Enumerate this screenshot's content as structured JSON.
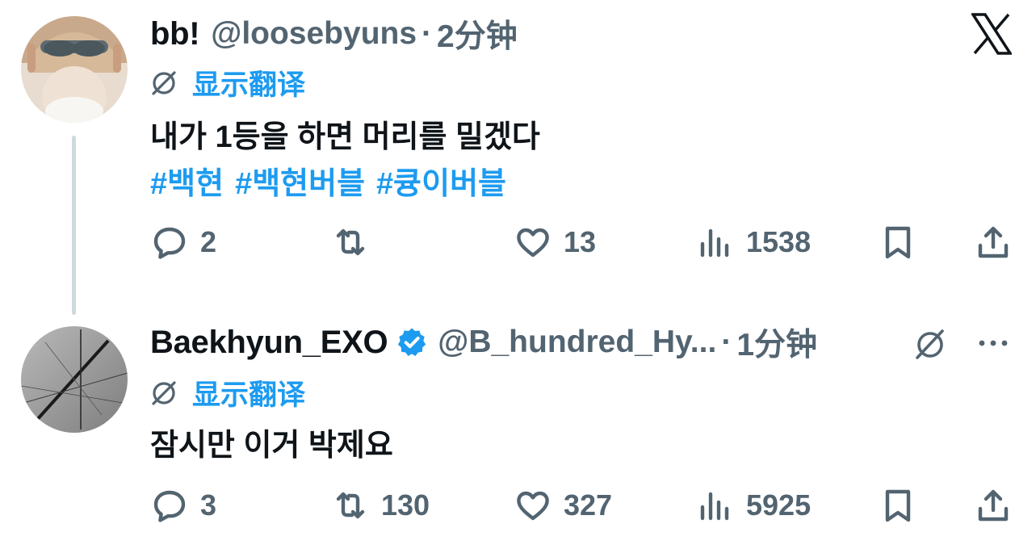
{
  "tweet1": {
    "display_name": "bb!",
    "handle": "@loosebyuns",
    "separator": "·",
    "time": "2分钟",
    "translate_label": "显示翻译",
    "text": "내가 1등을 하면 머리를 밀겠다",
    "hashtags": [
      "#백현",
      "#백현버블",
      "#큥이버블"
    ],
    "actions": {
      "replies": "2",
      "retweets": "",
      "likes": "13",
      "views": "1538"
    }
  },
  "tweet2": {
    "display_name": "Baekhyun_EXO",
    "handle": "@B_hundred_Hy...",
    "separator": "·",
    "time": "1分钟",
    "translate_label": "显示翻译",
    "text": "잠시만 이거 박제요",
    "actions": {
      "replies": "3",
      "retweets": "130",
      "likes": "327",
      "views": "5925"
    }
  },
  "icons": [
    "x-logo-icon",
    "translate-icon",
    "reply-icon",
    "retweet-icon",
    "like-icon",
    "views-icon",
    "bookmark-icon",
    "share-icon",
    "verified-badge-icon",
    "grok-icon",
    "more-icon"
  ],
  "colors": {
    "accent": "#1d9bf0",
    "secondary_text": "#536471",
    "primary_text": "#0f1419",
    "thread_line": "#cfd9de"
  }
}
